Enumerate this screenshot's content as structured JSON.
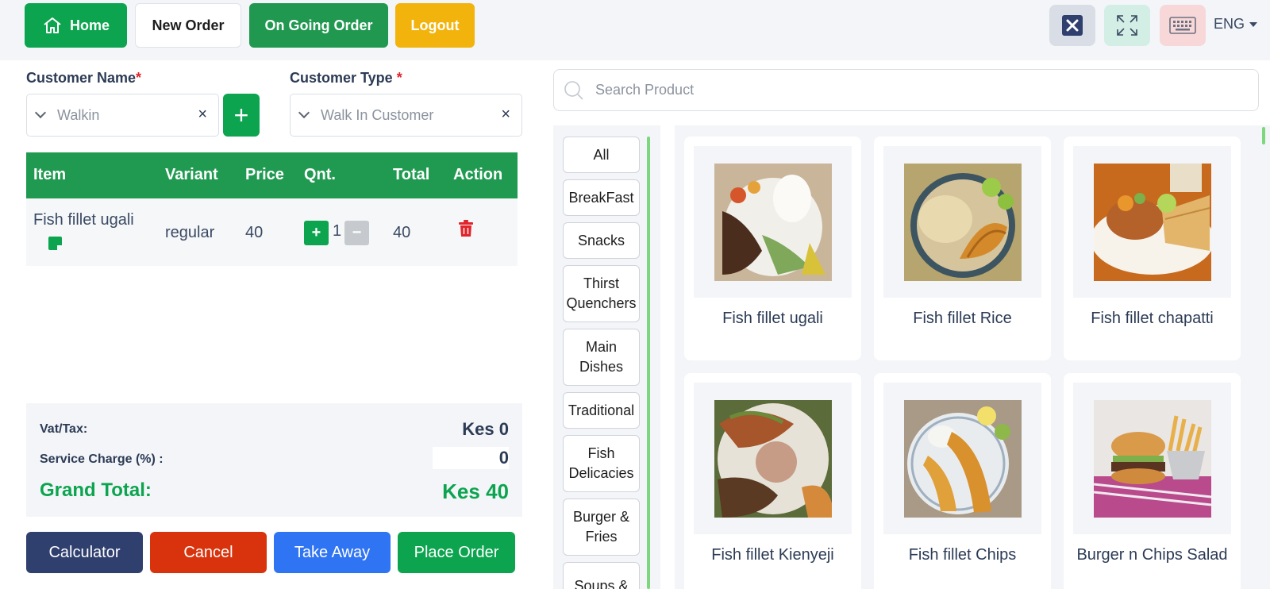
{
  "topbar": {
    "home_label": "Home",
    "new_order_label": "New Order",
    "ongoing_label": "On Going Order",
    "logout_label": "Logout",
    "language": "ENG",
    "icons": [
      "close-icon",
      "fullscreen-icon",
      "keyboard-icon"
    ]
  },
  "customer": {
    "name_label": "Customer Name",
    "name_required": "*",
    "name_value": "Walkin",
    "type_label": "Customer Type",
    "type_required": "*",
    "type_value": "Walk In Customer",
    "clear_symbol": "×",
    "add_symbol": "+"
  },
  "order_table": {
    "headers": [
      "Item",
      "Variant",
      "Price",
      "Qnt.",
      "Total",
      "Action"
    ],
    "rows": [
      {
        "item": "Fish fillet ugali",
        "variant": "regular",
        "price": "40",
        "qty": "1",
        "total": "40"
      }
    ],
    "plus_symbol": "+",
    "minus_symbol": "−"
  },
  "totals": {
    "vat_label": "Vat/Tax:",
    "vat_value": "Kes 0",
    "service_label": "Service Charge (%) :",
    "service_value": "0",
    "grand_label": "Grand Total:",
    "grand_value": "Kes 40"
  },
  "actions": {
    "calculator": "Calculator",
    "cancel": "Cancel",
    "take_away": "Take Away",
    "place_order": "Place Order"
  },
  "search": {
    "placeholder": "Search Product"
  },
  "categories": [
    "All",
    "BreakFast",
    "Snacks",
    "Thirst\nQuenchers",
    "Main\nDishes",
    "Traditional",
    "Fish\nDelicacies",
    "Burger &\nFries",
    "Soups &"
  ],
  "products": [
    {
      "name": "Fish fillet ugali"
    },
    {
      "name": "Fish fillet Rice"
    },
    {
      "name": "Fish fillet chapatti"
    },
    {
      "name": "Fish fillet Kienyeji"
    },
    {
      "name": "Fish fillet Chips"
    },
    {
      "name": "Burger n Chips Salad"
    }
  ],
  "colors": {
    "primary_green": "#0ca44f",
    "header_green": "#219a51",
    "logout_yellow": "#f2b40c",
    "cancel_red": "#d9330d",
    "take_away_blue": "#2f74f2",
    "calculator_navy": "#2f3f6e"
  }
}
